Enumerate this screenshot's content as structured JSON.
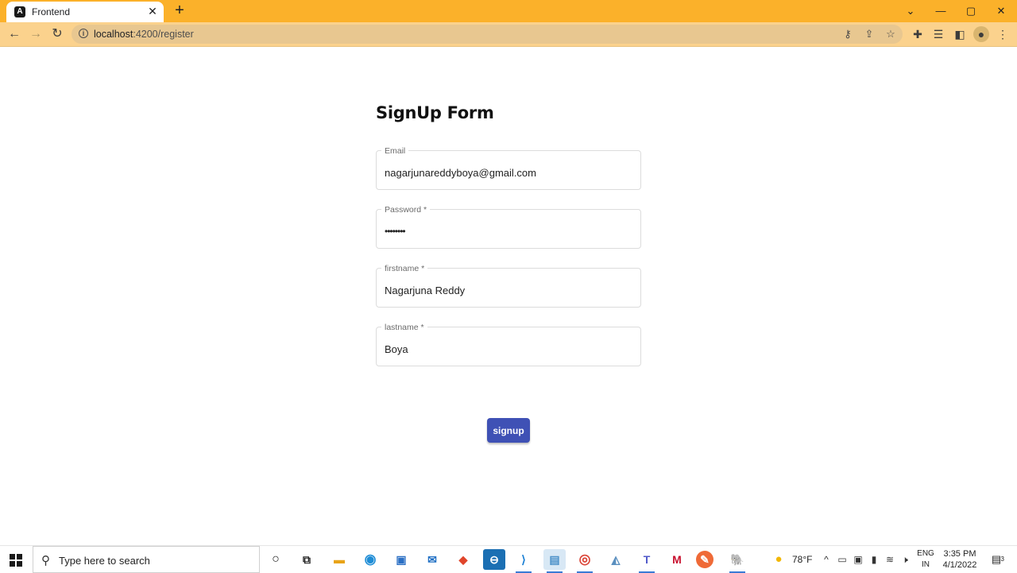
{
  "browser": {
    "tab_title": "Frontend",
    "tab_favicon_letter": "A",
    "tab_close": "✕",
    "new_tab": "+",
    "url_host": "localhost",
    "url_rest": ":4200/register",
    "window_controls": {
      "tabsearch": "⌄",
      "minimize": "—",
      "maximize": "▢",
      "close": "✕"
    },
    "nav": {
      "back": "←",
      "forward": "→",
      "reload": "↻"
    },
    "accent": "#fbb12a"
  },
  "form": {
    "title": "SignUp Form",
    "fields": [
      {
        "label": "Email",
        "value": "nagarjunareddyboya@gmail.com",
        "type": "text"
      },
      {
        "label": "Password *",
        "value": "••••••••",
        "type": "password"
      },
      {
        "label": "firstname *",
        "value": "Nagarjuna Reddy",
        "type": "text"
      },
      {
        "label": "lastname *",
        "value": "Boya",
        "type": "text"
      }
    ],
    "submit_label": "signup",
    "submit_color": "#3f51b5"
  },
  "taskbar": {
    "search_placeholder": "Type here to search",
    "weather": "78°F",
    "language": "ENG",
    "region": "IN",
    "time": "3:35 PM",
    "date": "4/1/2022",
    "notification_count": "3"
  }
}
